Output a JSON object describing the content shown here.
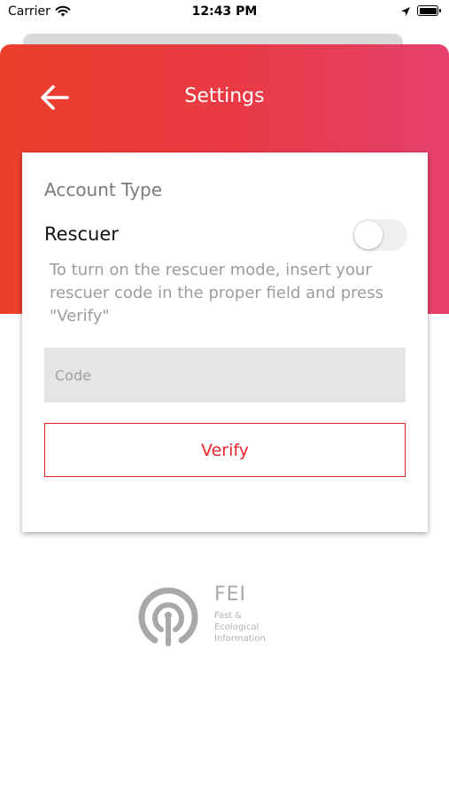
{
  "status_bar": {
    "carrier": "Carrier",
    "time": "12:43 PM"
  },
  "header": {
    "title": "Settings"
  },
  "account": {
    "section_title": "Account Type",
    "rescuer_label": "Rescuer",
    "rescuer_enabled": false,
    "helper_text": "To turn on the rescuer mode, insert your rescuer code in the proper field and press \"Verify\"",
    "code": {
      "value": "",
      "placeholder": "Code"
    },
    "verify_label": "Verify"
  },
  "logo": {
    "name": "FEI",
    "tagline_lines": [
      "Fast &",
      "Ecological",
      "Information"
    ]
  },
  "colors": {
    "gradient_start": "#ec3f2a",
    "gradient_end": "#e5416c",
    "accent": "#e8252b",
    "input_bg": "#e5e5e5"
  },
  "icons": {
    "back": "arrow-left-icon",
    "wifi": "wifi-icon",
    "location": "location-arrow-icon",
    "battery": "battery-icon",
    "logo": "fei-logo-icon"
  }
}
